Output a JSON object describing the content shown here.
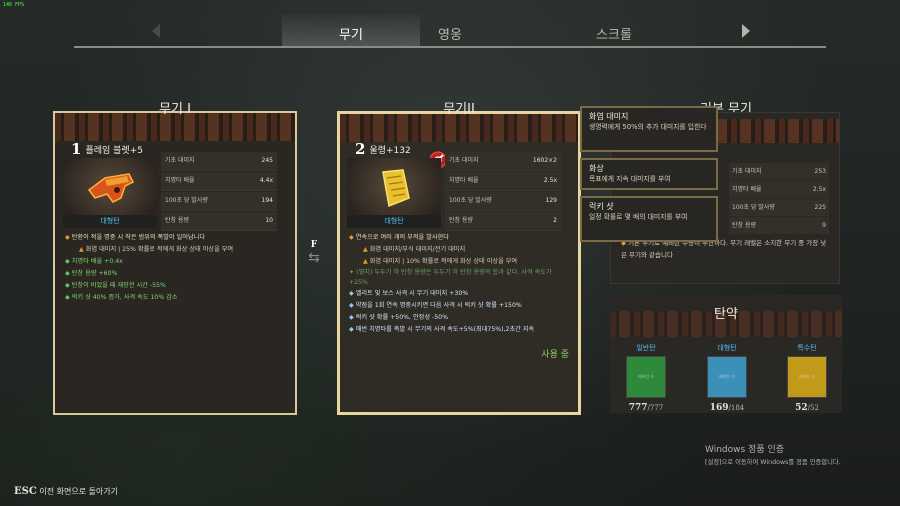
{
  "fps": "146 FPS",
  "tabs": [
    {
      "label": "무기",
      "active": true
    },
    {
      "label": "영웅",
      "active": false
    },
    {
      "label": "스크롤",
      "active": false
    }
  ],
  "weapon1": {
    "title": "무기 I",
    "slot": "1",
    "name": "플레임 블렛+5",
    "ammo_type": "대형탄",
    "stats": [
      {
        "label": "기초 대미지",
        "value": "245"
      },
      {
        "label": "치명타 배율",
        "value": "4.4x"
      },
      {
        "label": "100초 당 발사량",
        "value": "194"
      },
      {
        "label": "탄창 용량",
        "value": "10"
      }
    ],
    "desc_main": "탄환이 적을 명중 시 작은 범위의 폭발이 일어납니다",
    "desc_sub": "화염 대미지 | 25% 확률로 적에게 화상 상태 이상을 부여",
    "bonuses": [
      "치명타 배율 +0.4x",
      "탄창 용량 +60%",
      "탄창이 비었을 때 재장전 시간 -55%",
      "럭키 샷 40% 증가, 사격 속도 10% 감소"
    ]
  },
  "swap": {
    "key": "F",
    "symbol": "⇆"
  },
  "weapon2": {
    "title": "무기II",
    "slot": "2",
    "name": "울령+132",
    "ammo_type": "대형탄",
    "stats": [
      {
        "label": "기초 대미지",
        "value": "1602×2"
      },
      {
        "label": "치명타 배율",
        "value": "2.5x"
      },
      {
        "label": "100초 당 발사량",
        "value": "129"
      },
      {
        "label": "탄창 용량",
        "value": "2"
      }
    ],
    "desc_main": "연속으로 여러 개의 부적을 발사한다",
    "desc_subs": [
      "화염 대미지/부식 대미지/전기 대미지",
      "화염 대미지 | 10% 확률로 적에게 화상 상태 이상을 부여"
    ],
    "faint_note": "(영지) 두두기 하 탄창 용량은 두두기 하 탄창 용량의 합과 같다. 사격 속도가 +25%",
    "bonuses": [
      "엘리트 및 보스 사격 시 무기 대미지 +30%",
      "약점을 1회 연속 명중시키면 다음 사격 시 럭키 샷 확률 +150%",
      "럭키 샷 확률 +50%, 안정성 -50%",
      "매번 치명타를 촉발 시 무기의 사격 속도+5%(최대75%),2초간 지속"
    ],
    "in_use": "사용 중"
  },
  "basic_weapon": {
    "title": "기본 무기",
    "stats": [
      {
        "label": "기초 대미지",
        "value": "253"
      },
      {
        "label": "치명타 배율",
        "value": "2.5x"
      },
      {
        "label": "100초 당 발사량",
        "value": "225"
      },
      {
        "label": "탄창 용량",
        "value": "9"
      }
    ],
    "desc": "기본 무기로 예비탄 수량이 무한하다. 무기 레벨은 소지한 무기 중 가장 낮은 무기와 같습니다"
  },
  "tooltip": [
    {
      "title": "화염 대미지",
      "desc": "생명력에게 50%의 추가 대미지를 입힌다"
    },
    {
      "title": "화상",
      "desc": "목표에게 지속 대미지를 부여"
    },
    {
      "title": "럭키 샷",
      "desc": "일정 확률로 몇 배의 대미지를 부여"
    }
  ],
  "ammo": {
    "title": "탄약",
    "items": [
      {
        "label": "일반탄",
        "color": "#2e8a3a",
        "label_color": "#5ab8f0",
        "box_text": "예비탄 수",
        "current": "777",
        "max": "777"
      },
      {
        "label": "대형탄",
        "color": "#3c90b8",
        "label_color": "#5ab8f0",
        "box_text": "예비탄 수",
        "current": "169",
        "max": "184"
      },
      {
        "label": "특수탄",
        "color": "#c09a18",
        "label_color": "#5ab8f0",
        "box_text": "예비탄 수",
        "current": "52",
        "max": "52"
      }
    ]
  },
  "activation": {
    "line1": "Windows 정품 인증",
    "line2": "[설정]으로 이동하여 Windows를 정품 인증합니다."
  },
  "esc": {
    "key": "ESC",
    "label": "이전 화면으로 돌아가기"
  },
  "icons": {
    "left_arrow": "chevron-left-icon",
    "right_arrow": "chevron-right-icon",
    "swap": "swap-icon"
  }
}
